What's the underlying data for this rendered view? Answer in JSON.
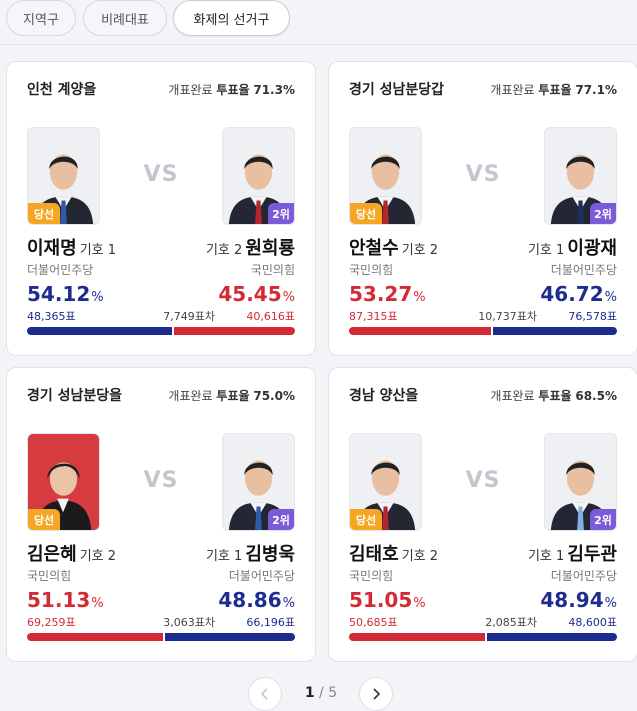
{
  "tabs": [
    {
      "label": "지역구"
    },
    {
      "label": "비례대표"
    },
    {
      "label": "화제의 선거구"
    }
  ],
  "common": {
    "vs": "VS",
    "status_prefix": "개표완료",
    "turnout_label": "투표율",
    "num_label": "기호",
    "diff_suffix": "표차",
    "pct_sym": "%",
    "win_badge": "당선",
    "rank_badge": "2위"
  },
  "colors": {
    "red": "#d42a35",
    "blue": "#1d2d8f",
    "win_badge": "#f5a623",
    "rank_badge": "#7b5bd6"
  },
  "cards": [
    {
      "district": "인천 계양을",
      "turnout": "71.3%",
      "diff": "7,749",
      "left": {
        "name": "이재명",
        "num": "1",
        "party": "더불어민주당",
        "pct": "54.12",
        "votes": "48,365표",
        "share": 54.12,
        "color": "blue",
        "badge": "win"
      },
      "right": {
        "name": "원희룡",
        "num": "2",
        "party": "국민의힘",
        "pct": "45.45",
        "votes": "40,616표",
        "share": 45.45,
        "color": "red",
        "badge": "rank"
      }
    },
    {
      "district": "경기 성남분당갑",
      "turnout": "77.1%",
      "diff": "10,737",
      "left": {
        "name": "안철수",
        "num": "2",
        "party": "국민의힘",
        "pct": "53.27",
        "votes": "87,315표",
        "share": 53.27,
        "color": "red",
        "badge": "win"
      },
      "right": {
        "name": "이광재",
        "num": "1",
        "party": "더불어민주당",
        "pct": "46.72",
        "votes": "76,578표",
        "share": 46.72,
        "color": "blue",
        "badge": "rank"
      }
    },
    {
      "district": "경기 성남분당을",
      "turnout": "75.0%",
      "diff": "3,063",
      "left": {
        "name": "김은혜",
        "num": "2",
        "party": "국민의힘",
        "pct": "51.13",
        "votes": "69,259표",
        "share": 51.13,
        "color": "red",
        "badge": "win"
      },
      "right": {
        "name": "김병욱",
        "num": "1",
        "party": "더불어민주당",
        "pct": "48.86",
        "votes": "66,196표",
        "share": 48.86,
        "color": "blue",
        "badge": "rank"
      }
    },
    {
      "district": "경남 양산을",
      "turnout": "68.5%",
      "diff": "2,085",
      "left": {
        "name": "김태호",
        "num": "2",
        "party": "국민의힘",
        "pct": "51.05",
        "votes": "50,685표",
        "share": 51.05,
        "color": "red",
        "badge": "win"
      },
      "right": {
        "name": "김두관",
        "num": "1",
        "party": "더불어민주당",
        "pct": "48.94",
        "votes": "48,600표",
        "share": 48.94,
        "color": "blue",
        "badge": "rank"
      }
    }
  ],
  "pagination": {
    "current": "1",
    "separator": "/",
    "total": "5"
  }
}
